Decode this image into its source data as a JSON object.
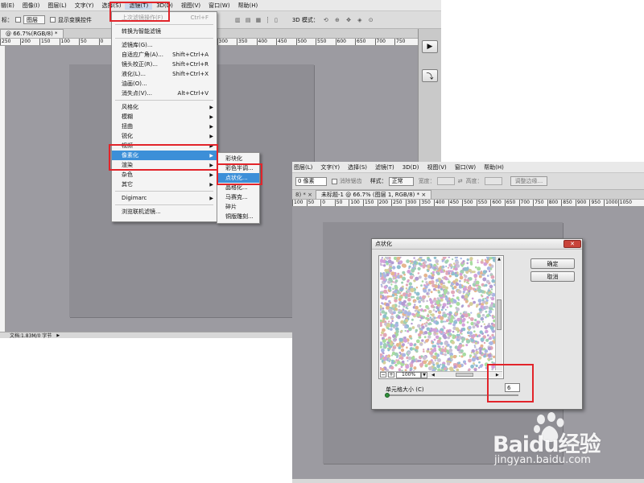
{
  "left_window": {
    "menubar": [
      "图像(I)",
      "图层(L)",
      "文字(Y)",
      "选择(S)",
      "滤镜(T)",
      "3D(D)",
      "视图(V)",
      "窗口(W)",
      "帮助(H)"
    ],
    "menubar_prefix": "辑(E)",
    "options": {
      "prefix": "标：",
      "layer_select": "图层",
      "show_transform": "显示变换控件",
      "mode_label": "3D 模式："
    },
    "tab": "@ 66.7%(RGB/8) *",
    "ruler": [
      "250",
      "200",
      "150",
      "100",
      "50",
      "0",
      "50",
      "100",
      "150",
      "200",
      "250",
      "300",
      "350",
      "400",
      "450",
      "500",
      "550",
      "600",
      "650",
      "700",
      "750"
    ],
    "status": "文档:1.83M/0 字节"
  },
  "filter_menu": {
    "items": [
      {
        "label": "上次滤镜操作(F)",
        "shortcut": "Ctrl+F",
        "disabled": true
      },
      {
        "sep": true
      },
      {
        "label": "转换为智能滤镜"
      },
      {
        "sep": true
      },
      {
        "label": "滤镜库(G)..."
      },
      {
        "label": "自适应广角(A)...",
        "shortcut": "Shift+Ctrl+A"
      },
      {
        "label": "镜头校正(R)...",
        "shortcut": "Shift+Ctrl+R"
      },
      {
        "label": "液化(L)...",
        "shortcut": "Shift+Ctrl+X"
      },
      {
        "label": "油画(O)..."
      },
      {
        "label": "消失点(V)...",
        "shortcut": "Alt+Ctrl+V"
      },
      {
        "sep": true
      },
      {
        "label": "风格化",
        "sub": true
      },
      {
        "label": "模糊",
        "sub": true
      },
      {
        "label": "扭曲",
        "sub": true
      },
      {
        "label": "锐化",
        "sub": true
      },
      {
        "label": "视频",
        "sub": true
      },
      {
        "label": "像素化",
        "sub": true,
        "highlight": true
      },
      {
        "label": "渲染",
        "sub": true
      },
      {
        "label": "杂色",
        "sub": true
      },
      {
        "label": "其它",
        "sub": true
      },
      {
        "sep": true
      },
      {
        "label": "Digimarc",
        "sub": true
      },
      {
        "sep": true
      },
      {
        "label": "浏览联机滤镜..."
      }
    ],
    "submenu": [
      {
        "label": "彩块化"
      },
      {
        "label": "彩色半调..."
      },
      {
        "label": "点状化...",
        "highlight": true
      },
      {
        "label": "晶格化..."
      },
      {
        "label": "马赛克..."
      },
      {
        "label": "碎片"
      },
      {
        "label": "铜版雕刻..."
      }
    ]
  },
  "right_window": {
    "menubar": [
      "图层(L)",
      "文字(Y)",
      "选择(S)",
      "滤镜(T)",
      "3D(D)",
      "视图(V)",
      "窗口(W)",
      "帮助(H)"
    ],
    "options": {
      "feather_value": "0 像素",
      "anti_alias": "消除锯齿",
      "style_label": "样式：",
      "style_value": "正常",
      "width_label": "宽度：",
      "height_label": "高度：",
      "refine_button": "调整边缘..."
    },
    "tab_prefix": "8) * ×",
    "tab": "未标题-1 @ 66.7% (图层 1, RGB/8) * ×",
    "ruler": [
      "100",
      "50",
      "0",
      "50",
      "100",
      "150",
      "200",
      "250",
      "300",
      "350",
      "400",
      "450",
      "500",
      "550",
      "600",
      "650",
      "700",
      "750",
      "800",
      "850",
      "900",
      "950",
      "1000",
      "1050"
    ]
  },
  "dialog": {
    "title": "点状化",
    "ok": "确定",
    "cancel": "取消",
    "zoom_value": "100%",
    "cell_size_label": "单元格大小 (C)",
    "cell_size_value": "6",
    "colors": {
      "accent": "#3c8fd8",
      "annotation": "#e2242a"
    }
  },
  "watermark": {
    "brand": "Baidu经验",
    "url": "jingyan.baidu.com"
  }
}
